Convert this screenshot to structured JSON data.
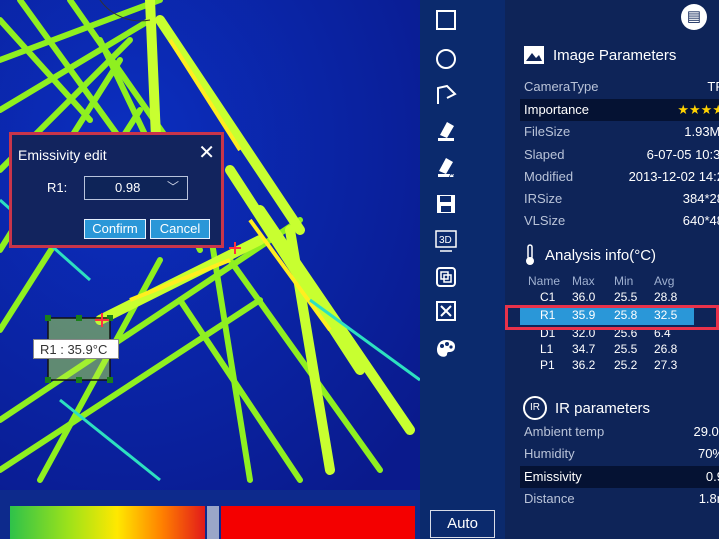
{
  "dialog": {
    "title": "Emissivity edit",
    "r1_label": "R1:",
    "emissivity_value": "0.98",
    "confirm_label": "Confirm",
    "cancel_label": "Cancel"
  },
  "roi_label": "R1 : 35.9°C",
  "toolbar": {
    "auto_label": "Auto",
    "icons": [
      "rectangle-icon",
      "circle-icon",
      "polygon-icon",
      "eraser-icon",
      "erase-all-icon",
      "save-icon",
      "3d-view-icon",
      "copy-icon",
      "clear-icon",
      "palette-icon"
    ]
  },
  "image_params": {
    "title": "Image Parameters",
    "rows": [
      {
        "k": "CameraType",
        "v": "TP"
      },
      {
        "k": "Importance",
        "v": "★★★★"
      },
      {
        "k": "FileSize",
        "v": "1.93MI"
      },
      {
        "k": "Slaped",
        "v": "6-07-05 10:3:"
      },
      {
        "k": "Modified",
        "v": "2013-12-02 14:2"
      },
      {
        "k": "IRSize",
        "v": "384*28"
      },
      {
        "k": "VLSize",
        "v": "640*48"
      }
    ]
  },
  "analysis": {
    "title": "Analysis info(°C)",
    "headers": [
      "Name",
      "Max",
      "Min",
      "Avg"
    ],
    "rows": [
      [
        "C1",
        "36.0",
        "25.5",
        "28.8"
      ],
      [
        "R1",
        "35.9",
        "25.8",
        "32.5"
      ],
      [
        "D1",
        "32.0",
        "25.6",
        "6.4"
      ],
      [
        "L1",
        "34.7",
        "25.5",
        "26.8"
      ],
      [
        "P1",
        "36.2",
        "25.2",
        "27.3"
      ]
    ]
  },
  "ir_params": {
    "title": "IR parameters",
    "icon_text": "IR",
    "rows": [
      {
        "k": "Ambient temp",
        "v": "29.0°"
      },
      {
        "k": "Humidity",
        "v": "70%"
      },
      {
        "k": "Emissivity",
        "v": "0.9"
      },
      {
        "k": "Distance",
        "v": "1.8n"
      }
    ]
  },
  "colors": {
    "accent": "#2a97d8",
    "highlight": "#e8324a",
    "panel": "#0e2458"
  }
}
